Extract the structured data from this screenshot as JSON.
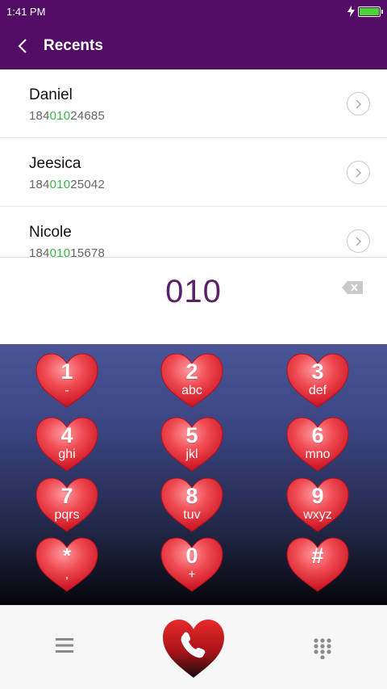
{
  "status_bar": {
    "time": "1:41 PM",
    "charging_icon": "lightning-icon",
    "battery_icon": "battery-full-icon"
  },
  "header": {
    "title": "Recents",
    "back_icon": "chevron-left-icon"
  },
  "recents": [
    {
      "name": "Daniel",
      "number_prefix": "184",
      "number_match": "010",
      "number_suffix": "24685"
    },
    {
      "name": "Jeesica",
      "number_prefix": "184",
      "number_match": "010",
      "number_suffix": "25042"
    },
    {
      "name": "Nicole",
      "number_prefix": "184",
      "number_match": "010",
      "number_suffix": "15678"
    }
  ],
  "dial_input": {
    "value": "010",
    "backspace_icon": "backspace-icon"
  },
  "keypad": {
    "keys": [
      {
        "digit": "1",
        "letters": "-"
      },
      {
        "digit": "2",
        "letters": "abc"
      },
      {
        "digit": "3",
        "letters": "def"
      },
      {
        "digit": "4",
        "letters": "ghi"
      },
      {
        "digit": "5",
        "letters": "jkl"
      },
      {
        "digit": "6",
        "letters": "mno"
      },
      {
        "digit": "7",
        "letters": "pqrs"
      },
      {
        "digit": "8",
        "letters": "tuv"
      },
      {
        "digit": "9",
        "letters": "wxyz"
      },
      {
        "digit": "*",
        "letters": ","
      },
      {
        "digit": "0",
        "letters": "+"
      },
      {
        "digit": "#",
        "letters": ""
      }
    ]
  },
  "bottom_bar": {
    "menu_icon": "menu-icon",
    "call_icon": "phone-icon",
    "keypad_icon": "dialpad-icon"
  },
  "colors": {
    "header": "#520d64",
    "digit_text": "#5b2168",
    "match_highlight": "#39b54a",
    "heart": "#e8323c"
  }
}
